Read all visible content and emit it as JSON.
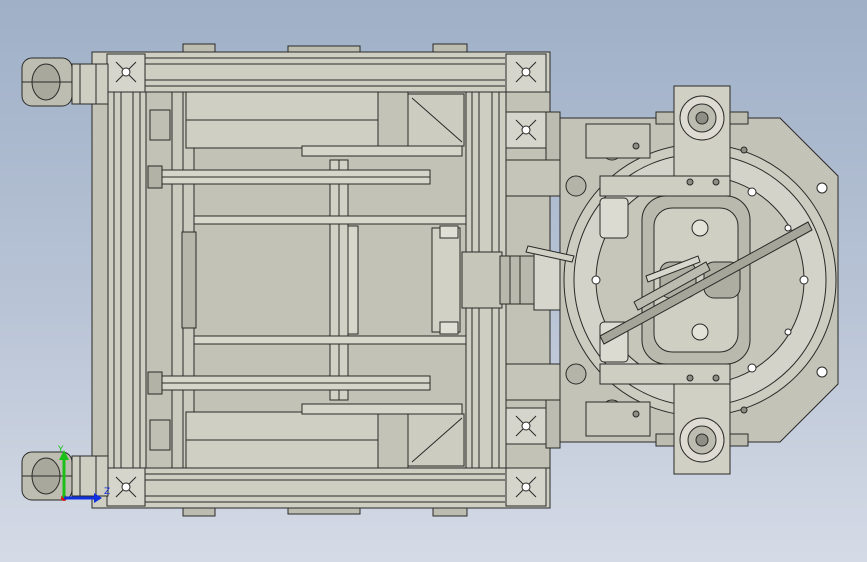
{
  "viewport": {
    "background_top": "#9fb0c7",
    "background_bottom": "#d5dbe6",
    "part_fill": "#c9c8bd",
    "part_fill_dark": "#a9a89c",
    "edge_color": "#2a2a28"
  },
  "triad": {
    "y_label": "Y",
    "z_label": "Z",
    "x_color": "#e01010",
    "y_color": "#18c018",
    "z_color": "#1030e0"
  }
}
